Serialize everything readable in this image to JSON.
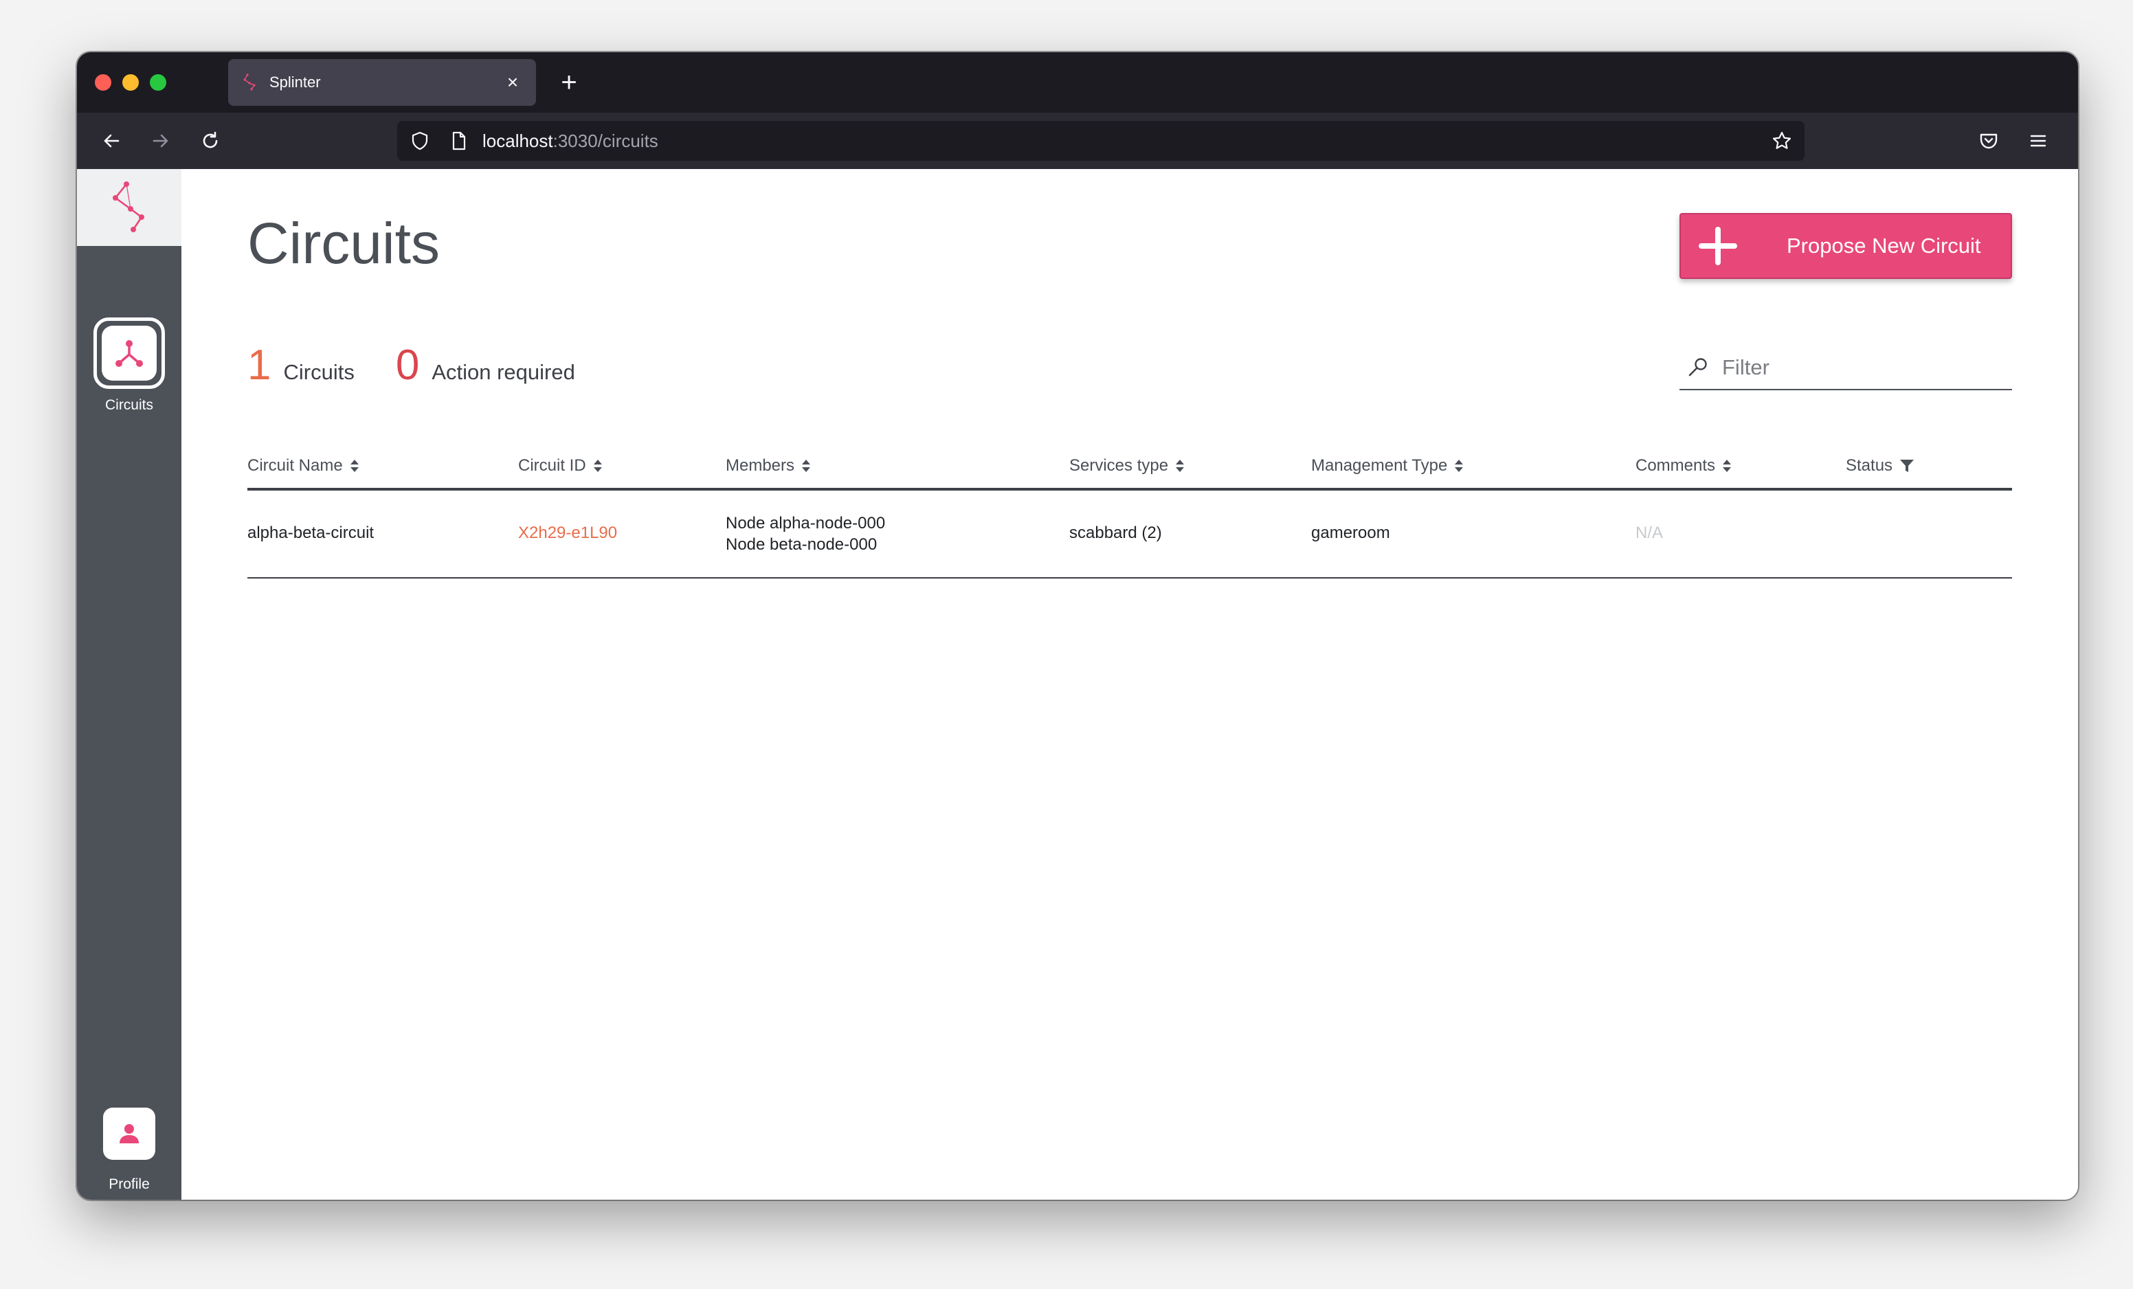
{
  "browser": {
    "tab_title": "Splinter",
    "tab_close": "×",
    "new_tab": "+",
    "url_host": "localhost",
    "url_path": ":3030/circuits"
  },
  "sidebar": {
    "items": [
      {
        "label": "Circuits",
        "icon": "circuit-icon"
      },
      {
        "label": "Profile",
        "icon": "person-icon"
      }
    ]
  },
  "main": {
    "title": "Circuits",
    "propose_button": "Propose New Circuit",
    "stats": {
      "circuits_count": "1",
      "circuits_label": "Circuits",
      "action_count": "0",
      "action_label": "Action required"
    },
    "filter_placeholder": "Filter",
    "table": {
      "headers": [
        "Circuit Name",
        "Circuit ID",
        "Members",
        "Services type",
        "Management Type",
        "Comments",
        "Status"
      ],
      "rows": [
        {
          "name": "alpha-beta-circuit",
          "id": "X2h29-e1L90",
          "members": [
            "Node alpha-node-000",
            "Node beta-node-000"
          ],
          "services": "scabbard (2)",
          "management": "gameroom",
          "comments": "N/A",
          "status": ""
        }
      ]
    }
  },
  "colors": {
    "accent": "#e8477a",
    "orange": "#e96c4a",
    "sidebar": "#4d5158"
  }
}
